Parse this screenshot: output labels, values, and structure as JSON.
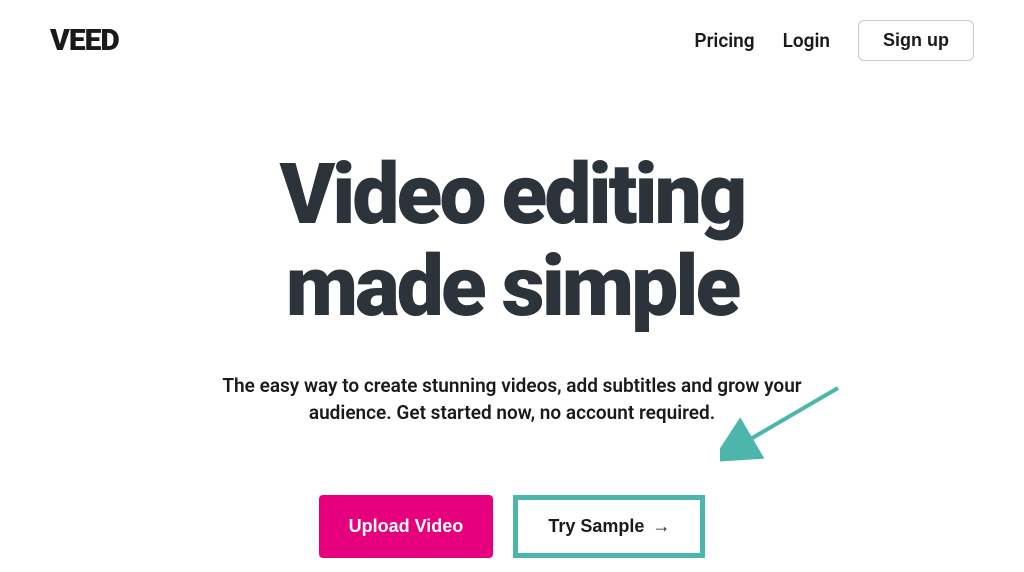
{
  "header": {
    "logo": "VEED",
    "nav": {
      "pricing": "Pricing",
      "login": "Login",
      "signup": "Sign up"
    }
  },
  "hero": {
    "title_line1": "Video editing",
    "title_line2": "made simple",
    "subtitle": "The easy way to create stunning videos, add subtitles and grow your audience. Get started now, no account required."
  },
  "cta": {
    "upload": "Upload Video",
    "sample": "Try Sample",
    "sample_arrow": "→"
  },
  "colors": {
    "primary_pink": "#e6007e",
    "teal_highlight": "#4db6ac",
    "text_dark": "#2d333a"
  }
}
